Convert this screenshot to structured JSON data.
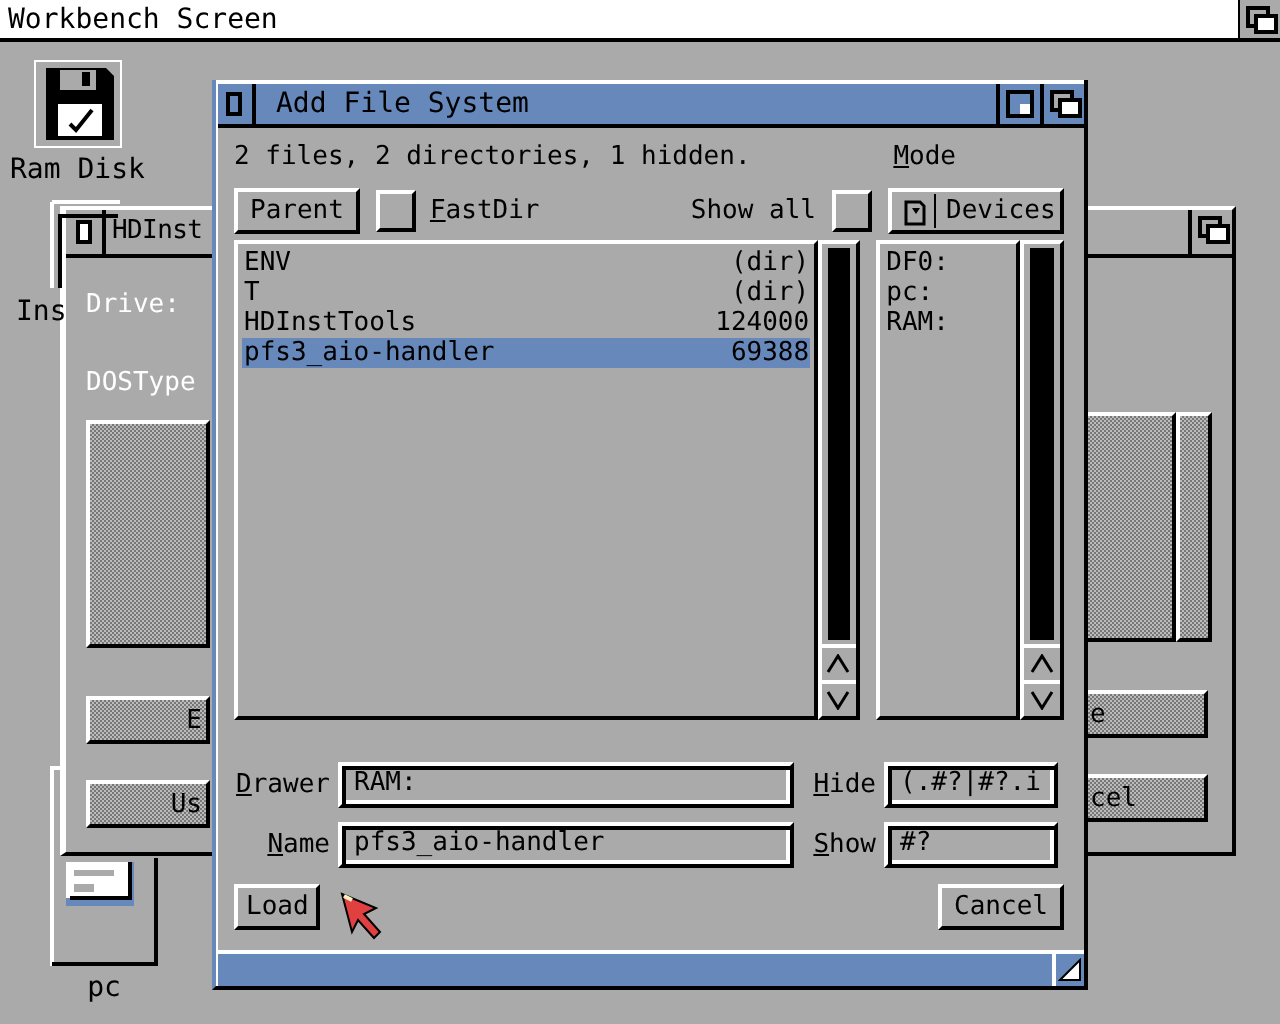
{
  "screen": {
    "title": "Workbench Screen"
  },
  "icons": [
    {
      "label": "Ram Disk",
      "kind": "disk"
    },
    {
      "label": "Ins",
      "kind": "drawer"
    },
    {
      "label": "pc",
      "kind": "drive"
    }
  ],
  "back_window": {
    "title": "HDInst",
    "drive_label": "Drive:",
    "dostype_label": "DOSType",
    "left_buttons": [
      "E",
      "Us"
    ],
    "right_buttons": [
      "e",
      "cel"
    ]
  },
  "dialog": {
    "title": "Add File System",
    "status": "2 files, 2 directories, 1 hidden.",
    "mode_label": "Mode",
    "parent_button": "Parent",
    "fastdir": {
      "label": "FastDir",
      "checked": false
    },
    "show_all": {
      "label": "Show all",
      "checked": false
    },
    "mode_button": "Devices",
    "files": [
      {
        "name": "ENV",
        "info": "(dir)",
        "selected": false
      },
      {
        "name": "T",
        "info": "(dir)",
        "selected": false
      },
      {
        "name": "HDInstTools",
        "info": "124000",
        "selected": false
      },
      {
        "name": "pfs3_aio-handler",
        "info": "69388",
        "selected": true
      }
    ],
    "devices": [
      {
        "name": "DF0:",
        "selected": false
      },
      {
        "name": "pc:",
        "selected": false
      },
      {
        "name": "RAM:",
        "selected": false
      }
    ],
    "drawer": {
      "label": "Drawer",
      "value": "RAM:"
    },
    "name": {
      "label": "Name",
      "value": "pfs3_aio-handler"
    },
    "hide": {
      "label": "Hide",
      "value": "(.#?|#?.i"
    },
    "show": {
      "label": "Show",
      "value": "#?"
    },
    "buttons": [
      "Load",
      "Cancel"
    ]
  }
}
